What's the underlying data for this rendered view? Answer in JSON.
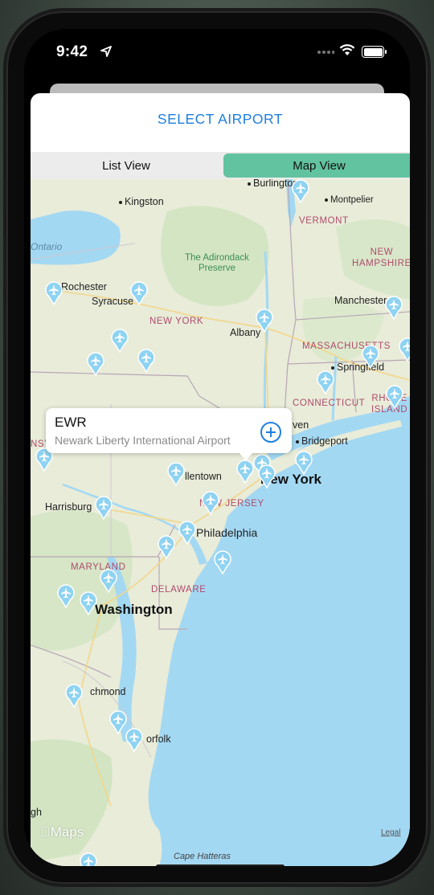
{
  "status": {
    "time": "9:42"
  },
  "sheet": {
    "title": "SELECT AIRPORT",
    "tabs": [
      {
        "label": "List View",
        "active": false
      },
      {
        "label": "Map View",
        "active": true
      }
    ]
  },
  "map": {
    "labels": {
      "burlington": "Burlington",
      "kingston": "Kingston",
      "montpelier": "Montpelier",
      "vermont": "VERMONT",
      "ontario": "Ontario",
      "adirondack": "The Adirondack\nPreserve",
      "new_hampshire": "NEW\nHAMPSHIRE",
      "rochester": "Rochester",
      "syracuse": "Syracuse",
      "manchester": "Manchester",
      "new_york_state": "NEW YORK",
      "albany": "Albany",
      "massachusetts": "MASSACHUSETTS",
      "springfield": "Springfield",
      "connecticut": "CONNECTICUT",
      "rhode_island": "RHODE\nISLAND",
      "new_haven": "ven",
      "bridgeport": "Bridgeport",
      "allentown": "llentown",
      "new_york_city": "New York",
      "new_jersey": "NEW JERSEY",
      "harrisburg": "Harrisburg",
      "philadelphia": "Philadelphia",
      "maryland": "MARYLAND",
      "delaware": "DELAWARE",
      "washington": "Washington",
      "richmond": "chmond",
      "norfolk": "orfolk",
      "raleigh": "gh",
      "cape_hatteras": "Cape Hatteras",
      "pa_fragment": "NSY"
    },
    "callout": {
      "code": "EWR",
      "name": "Newark Liberty International Airport",
      "add_icon": "plus-circle-icon"
    },
    "attribution": {
      "logo_text": "Maps",
      "legal": "Legal"
    }
  },
  "colors": {
    "accent": "#1f7fe0",
    "segment_active": "#62c3a0",
    "land": "#e8ecd9",
    "water": "#a3d8f3",
    "state_label": "#b04b6c"
  }
}
